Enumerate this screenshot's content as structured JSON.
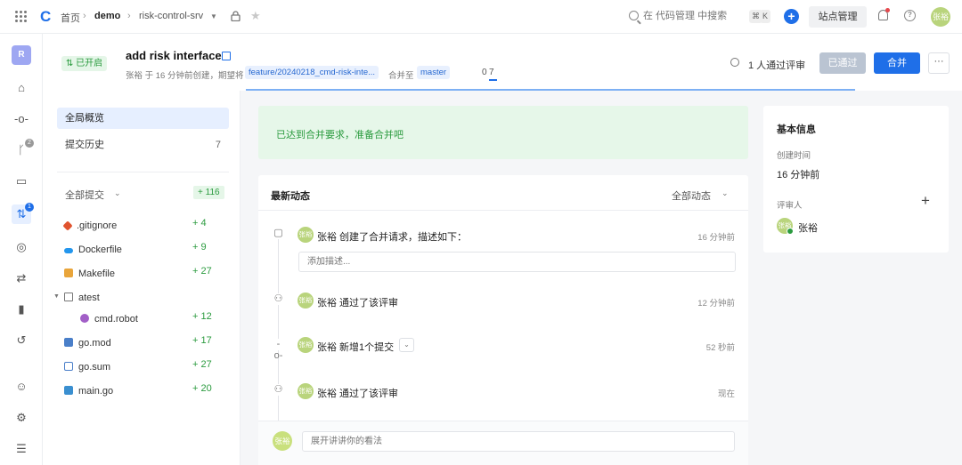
{
  "topbar": {
    "breadcrumbs": [
      "首页",
      "demo",
      "risk-control-srv"
    ],
    "search_placeholder": "在 代码管理 中搜索",
    "shortcut_keys": [
      "⌘",
      "K"
    ],
    "site_admin_label": "站点管理",
    "avatar_text": "张裕"
  },
  "rail": {
    "repo_initial": "R",
    "badges": {
      "branches": "2",
      "merge_requests": "1"
    }
  },
  "header": {
    "status": "已开启",
    "title": "add risk interface",
    "meta_prefix": "张裕 于 16 分钟前创建，期望将",
    "source_branch": "feature/20240218_cmd-risk-inte...",
    "meta_mid": "合并至",
    "target_branch": "master",
    "tab_counts": [
      "0",
      "7"
    ],
    "reviewers_summary": "1 人通过评审",
    "passed_label": "已通过",
    "merge_label": "合并",
    "more_label": "···",
    "progress_percent": 100
  },
  "file_panel": {
    "nav": [
      {
        "label": "全局概览",
        "count": ""
      },
      {
        "label": "提交历史",
        "count": "7"
      }
    ],
    "all_commits_label": "全部提交",
    "total_added": "+ 116",
    "files": [
      {
        "name": ".gitignore",
        "added": "+ 4",
        "icon": "git-icon",
        "color": "#e0532e"
      },
      {
        "name": "Dockerfile",
        "added": "+ 9",
        "icon": "docker-icon",
        "color": "#2396ed"
      },
      {
        "name": "Makefile",
        "added": "+ 27",
        "icon": "makefile-icon",
        "color": "#e9a53b"
      },
      {
        "name": "atest",
        "added": "",
        "icon": "folder-icon",
        "color": "#777777"
      },
      {
        "name": "cmd.robot",
        "added": "+ 12",
        "icon": "robot-icon",
        "color": "#a25fc7"
      },
      {
        "name": "go.mod",
        "added": "+ 17",
        "icon": "go-mod-icon",
        "color": "#4a7fc9"
      },
      {
        "name": "go.sum",
        "added": "+ 27",
        "icon": "go-sum-icon",
        "color": "#4a7fc9"
      },
      {
        "name": "main.go",
        "added": "+ 20",
        "icon": "go-file-icon",
        "color": "#3a8fd0"
      }
    ]
  },
  "main": {
    "ready_text": "已达到合并要求，准备合并吧",
    "feed_title": "最新动态",
    "feed_filter": "全部动态",
    "events": [
      {
        "avatar": "张裕",
        "text": "张裕 创建了合并请求，描述如下：",
        "time": "16 分钟前"
      },
      {
        "avatar": "张裕",
        "text": "张裕 通过了该评审",
        "time": "12 分钟前"
      },
      {
        "avatar": "张裕",
        "text": "张裕 新增1个提交",
        "time": "52 秒前"
      },
      {
        "avatar": "张裕",
        "text": "张裕 通过了该评审",
        "time": "现在"
      }
    ],
    "description_placeholder": "添加描述...",
    "comment_avatar": "张裕",
    "comment_placeholder": "展开讲讲你的看法"
  },
  "info": {
    "title": "基本信息",
    "created_label": "创建时间",
    "created_value": "16 分钟前",
    "reviewers_label": "评审人",
    "reviewer_avatar": "张裕",
    "reviewer_name": "张裕"
  }
}
